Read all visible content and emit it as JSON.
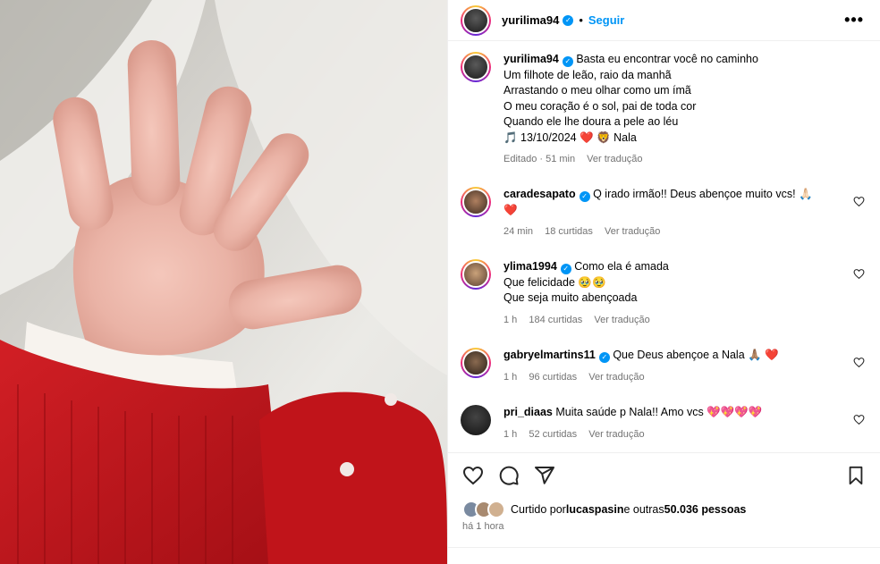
{
  "post": {
    "username": "yurilima94",
    "follow_label": "Seguir",
    "more_label": "•••",
    "caption_lines": [
      "Basta eu encontrar você no caminho",
      "Um filhote de leão, raio da manhã",
      "Arrastando o meu olhar como um ímã",
      "O meu coração é o sol, pai de toda cor",
      "Quando ele lhe doura a pele ao léu"
    ],
    "caption_last_line": "🎵 13/10/2024 ❤️ 🦁 Nala",
    "caption_edited": "Editado · 51 min",
    "caption_translate": "Ver tradução"
  },
  "comments": [
    {
      "username": "caradesapato",
      "text": "Q irado irmão!! Deus abençoe muito vcs! 🙏🏻",
      "text2": "❤️",
      "time": "24 min",
      "likes": "18 curtidas",
      "translate": "Ver tradução"
    },
    {
      "username": "ylima1994",
      "text": "Como ela é amada",
      "text2": "Que felicidade 🥹🥹",
      "text3": "Que seja muito abençoada",
      "time": "1 h",
      "likes": "184 curtidas",
      "translate": "Ver tradução"
    },
    {
      "username": "gabryelmartins11",
      "text": "Que Deus abençoe a Nala 🙏🏽 ❤️",
      "time": "1 h",
      "likes": "96 curtidas",
      "translate": "Ver tradução"
    },
    {
      "username": "pri_diaas",
      "text": "Muita saúde p Nala!! Amo vcs 💖💖💖💖",
      "time": "1 h",
      "likes": "52 curtidas",
      "translate": "Ver tradução"
    }
  ],
  "footer": {
    "liked_by_prefix": "Curtido por ",
    "liked_by_user": "lucaspasin",
    "liked_by_suffix": " e outras ",
    "liked_count": "50.036 pessoas",
    "time_ago": "há 1 hora"
  },
  "icons": {
    "verified": "verified-badge-icon",
    "heart": "heart-icon",
    "comment": "comment-icon",
    "share": "share-icon",
    "save": "bookmark-icon"
  },
  "colors": {
    "accent": "#0095f6",
    "muted": "#737373",
    "sweater_red": "#c3161c"
  }
}
